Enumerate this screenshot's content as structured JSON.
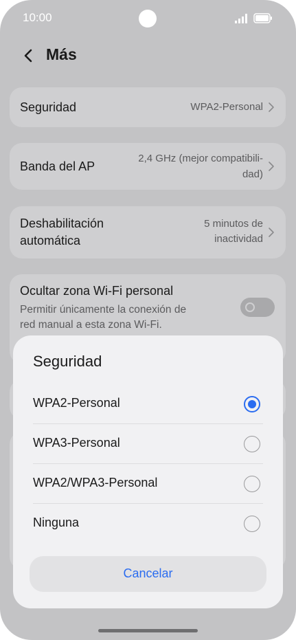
{
  "status_bar": {
    "time": "10:00"
  },
  "header": {
    "title": "Más"
  },
  "settings": {
    "security": {
      "label": "Seguridad",
      "value": "WPA2-Personal"
    },
    "band": {
      "label": "Banda del AP",
      "value_line1": "2,4 GHz (mejor compatibili-",
      "value_line2": "dad)"
    },
    "auto_disable": {
      "label_line1": "Deshabilitación",
      "label_line2": "automática",
      "value_line1": "5 minutos de",
      "value_line2": "inactividad"
    },
    "hide_hotspot": {
      "label": "Ocultar zona Wi-Fi personal",
      "description_line1": "Permitir únicamente la conexión de",
      "description_line2": "red manual a esta zona Wi-Fi.",
      "enabled": false
    }
  },
  "dialog": {
    "title": "Seguridad",
    "options": [
      {
        "label": "WPA2-Personal",
        "selected": true
      },
      {
        "label": "WPA3-Personal",
        "selected": false
      },
      {
        "label": "WPA2/WPA3-Personal",
        "selected": false
      },
      {
        "label": "Ninguna",
        "selected": false
      }
    ],
    "cancel_label": "Cancelar"
  },
  "colors": {
    "accent": "#2a6cf0",
    "backdrop": "#c3c3c5",
    "card": "#cfcfd1",
    "dialog": "#f1f1f3"
  },
  "icons": [
    "back-arrow-icon",
    "chevron-right-icon",
    "signal-icon",
    "battery-icon",
    "camera-cutout"
  ]
}
